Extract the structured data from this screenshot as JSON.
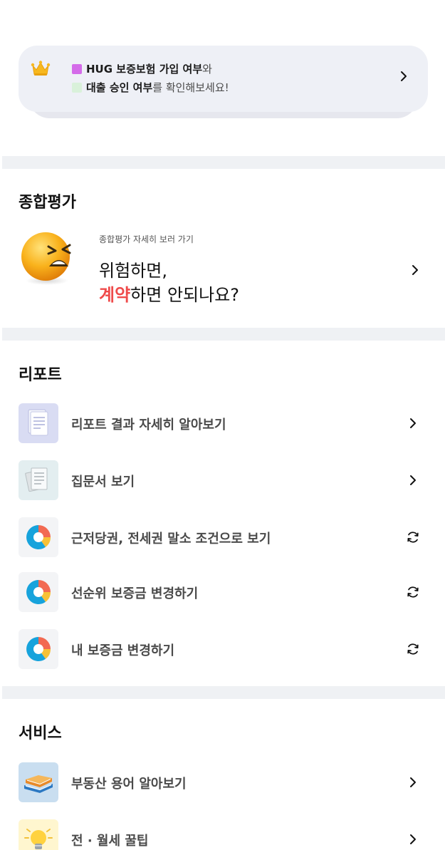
{
  "banner": {
    "line1_bold": "HUG 보증보험 가입 여부",
    "line1_tail": "와",
    "line2_bold": "대출 승인 여부",
    "line2_tail": "를 확인해보세요!",
    "icon": "crown-icon",
    "colors": {
      "marker1": "#d46be9",
      "marker2": "#d9f1da"
    }
  },
  "evaluation": {
    "title": "종합평가",
    "subtitle": "종합평가 자세히 보러 가기",
    "line1": "위험하면,",
    "highlight": "계약",
    "line2_tail": "하면 안되나요?",
    "highlight_color": "#ef4a4a"
  },
  "report": {
    "title": "리포트",
    "items": [
      {
        "label": "리포트 결과 자세히 알아보기",
        "icon": "document-icon",
        "action": "chevron"
      },
      {
        "label": "집문서 보기",
        "icon": "papers-icon",
        "action": "chevron"
      },
      {
        "label": "근저당권, 전세권 말소 조건으로 보기",
        "icon": "pie-chart-icon",
        "action": "refresh"
      },
      {
        "label": "선순위 보증금 변경하기",
        "icon": "pie-chart-icon",
        "action": "refresh"
      },
      {
        "label": "내 보증금 변경하기",
        "icon": "pie-chart-icon",
        "action": "refresh"
      }
    ]
  },
  "service": {
    "title": "서비스",
    "items": [
      {
        "label": "부동산 용어 알아보기",
        "icon": "books-icon",
        "action": "chevron"
      },
      {
        "label": "전 · 월세 꿀팁",
        "icon": "lightbulb-icon",
        "action": "chevron"
      }
    ]
  }
}
